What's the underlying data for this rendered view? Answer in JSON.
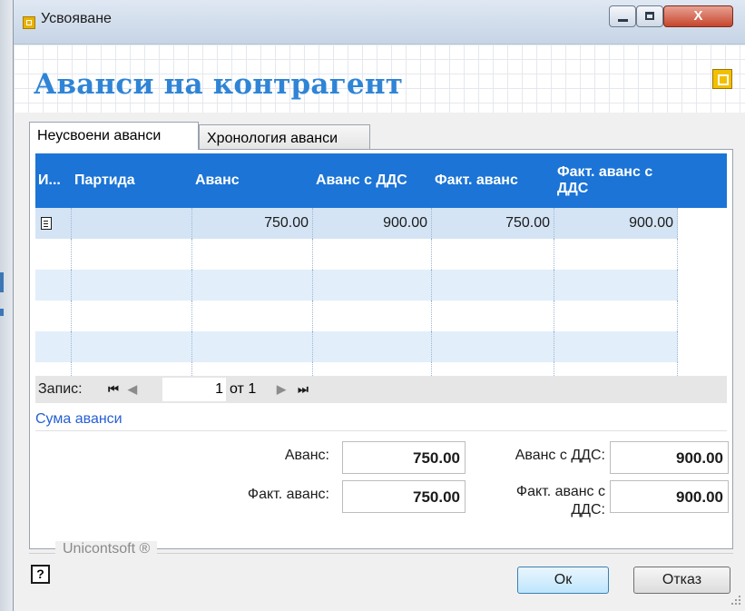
{
  "window": {
    "title": "Усвояване",
    "close_glyph": "X"
  },
  "header": {
    "title": "Аванси на контрагент"
  },
  "tabs": [
    {
      "label": "Неусвоени аванси",
      "active": true
    },
    {
      "label": "Хронология аванси",
      "active": false
    }
  ],
  "grid": {
    "columns": [
      "И...",
      "Партида",
      "Аванс",
      "Аванс с ДДС",
      "Факт. аванс",
      "Факт. аванс с ДДС"
    ],
    "rows": [
      {
        "icon": "document-icon",
        "partida": "",
        "avans": "750.00",
        "avans_dds": "900.00",
        "fakt_avans": "750.00",
        "fakt_avans_dds": "900.00"
      }
    ]
  },
  "navigator": {
    "label": "Запис:",
    "current": "1",
    "of_text": "от 1",
    "first": "⏮",
    "prev": "◀",
    "next": "▶",
    "last": "⏭"
  },
  "summary": {
    "section_label": "Сума аванси",
    "avans_label": "Аванс:",
    "avans_value": "750.00",
    "avans_dds_label": "Аванс с ДДС:",
    "avans_dds_value": "900.00",
    "fakt_avans_label": "Факт. аванс:",
    "fakt_avans_value": "750.00",
    "fakt_avans_dds_label_line1": "Факт. аванс с",
    "fakt_avans_dds_label_line2": "ДДС:",
    "fakt_avans_dds_value": "900.00"
  },
  "footer": {
    "brand": "Unicontsoft ®",
    "help_glyph": "?",
    "ok_label": "Ок",
    "cancel_label": "Отказ"
  },
  "colors": {
    "accent": "#1b74d6",
    "title": "#2f84d6",
    "link": "#2660d4"
  }
}
